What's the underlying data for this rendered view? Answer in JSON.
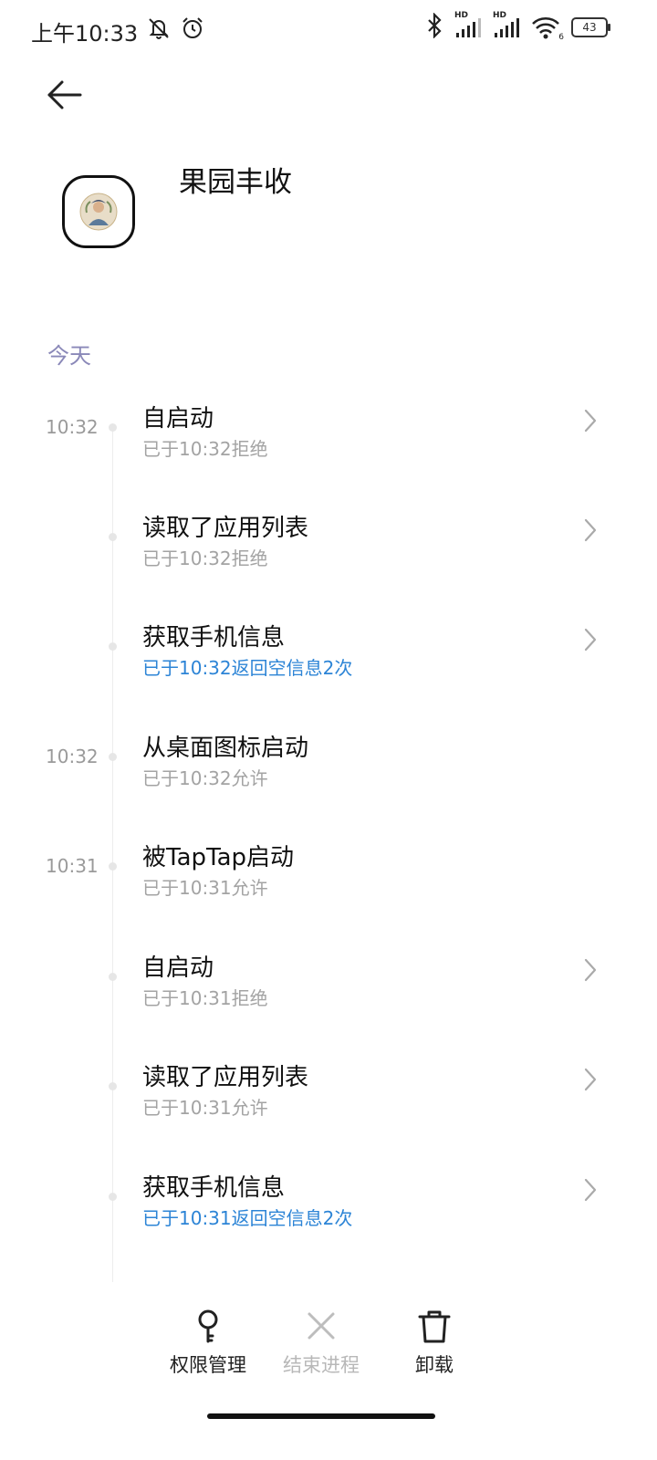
{
  "status_bar": {
    "time": "上午10:33",
    "network_label_1": "HD",
    "network_label_2": "HD",
    "wifi_sub": "6",
    "battery": "43"
  },
  "header": {
    "app_name": "果园丰收"
  },
  "section": {
    "label": "今天"
  },
  "events": [
    {
      "time": "10:32",
      "title": "自启动",
      "status": "已于10:32拒绝",
      "highlight": false,
      "has_chevron": true
    },
    {
      "time": "",
      "title": "读取了应用列表",
      "status": "已于10:32拒绝",
      "highlight": false,
      "has_chevron": true
    },
    {
      "time": "",
      "title": "获取手机信息",
      "status": "已于10:32返回空信息2次",
      "highlight": true,
      "has_chevron": true
    },
    {
      "time": "10:32",
      "title": "从桌面图标启动",
      "status": "已于10:32允许",
      "highlight": false,
      "has_chevron": false
    },
    {
      "time": "10:31",
      "title": "被TapTap启动",
      "status": "已于10:31允许",
      "highlight": false,
      "has_chevron": false
    },
    {
      "time": "",
      "title": "自启动",
      "status": "已于10:31拒绝",
      "highlight": false,
      "has_chevron": true
    },
    {
      "time": "",
      "title": "读取了应用列表",
      "status": "已于10:31允许",
      "highlight": false,
      "has_chevron": true
    },
    {
      "time": "",
      "title": "获取手机信息",
      "status": "已于10:31返回空信息2次",
      "highlight": true,
      "has_chevron": true
    }
  ],
  "actions": {
    "permissions": {
      "label": "权限管理",
      "icon": "key-icon",
      "enabled": true
    },
    "end_process": {
      "label": "结束进程",
      "icon": "close-icon",
      "enabled": false
    },
    "uninstall": {
      "label": "卸载",
      "icon": "trash-icon",
      "enabled": true
    }
  },
  "colors": {
    "accent_blue": "#2c84d6",
    "section_label": "#8a88b8",
    "secondary_text": "#a3a3a3"
  }
}
